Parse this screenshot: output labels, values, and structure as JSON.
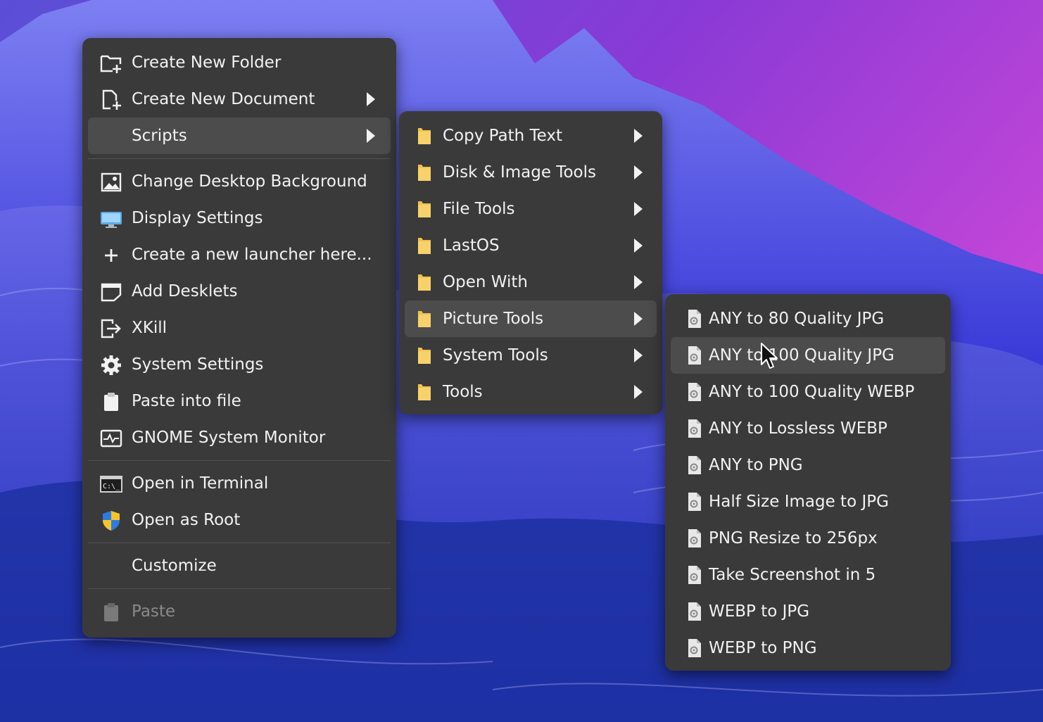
{
  "main_menu": {
    "items": [
      {
        "label": "Create New Folder",
        "icon": "folder-add-icon"
      },
      {
        "label": "Create New Document",
        "icon": "document-add-icon",
        "submenu": true
      },
      {
        "label": "Scripts",
        "icon": "",
        "submenu": true,
        "highlighted": true
      }
    ],
    "group2": [
      {
        "label": "Change Desktop Background",
        "icon": "image-icon"
      },
      {
        "label": "Display Settings",
        "icon": "monitor-icon"
      },
      {
        "label": "Create a new launcher here...",
        "icon": "plus-icon"
      },
      {
        "label": "Add Desklets",
        "icon": "desklet-icon"
      },
      {
        "label": "XKill",
        "icon": "exit-icon"
      },
      {
        "label": "System Settings",
        "icon": "gear-icon"
      },
      {
        "label": "Paste into file",
        "icon": "clipboard-icon"
      },
      {
        "label": "GNOME System Monitor",
        "icon": "system-monitor-icon"
      }
    ],
    "group3": [
      {
        "label": "Open in Terminal",
        "icon": "terminal-icon"
      },
      {
        "label": "Open as Root",
        "icon": "shield-icon"
      }
    ],
    "customize": "Customize",
    "paste": "Paste"
  },
  "scripts_menu": {
    "items": [
      {
        "label": "Copy Path Text"
      },
      {
        "label": "Disk & Image Tools"
      },
      {
        "label": "File Tools"
      },
      {
        "label": "LastOS"
      },
      {
        "label": "Open With"
      },
      {
        "label": "Picture Tools",
        "highlighted": true
      },
      {
        "label": "System Tools"
      },
      {
        "label": "Tools"
      }
    ]
  },
  "picture_menu": {
    "items": [
      {
        "label": "ANY to 80 Quality JPG"
      },
      {
        "label": "ANY to 100 Quality JPG",
        "highlighted": true
      },
      {
        "label": "ANY to 100 Quality WEBP"
      },
      {
        "label": "ANY to Lossless WEBP"
      },
      {
        "label": "ANY to PNG"
      },
      {
        "label": "Half Size Image to JPG"
      },
      {
        "label": "PNG Resize to 256px"
      },
      {
        "label": "Take Screenshot in 5"
      },
      {
        "label": "WEBP to JPG"
      },
      {
        "label": "WEBP to PNG"
      }
    ]
  },
  "colors": {
    "menu_bg": "#3a3a3a",
    "highlight": "#4c4c4c",
    "text": "#f2f2f2",
    "disabled_text": "#8a8a8a",
    "folder": "#f2c14e"
  }
}
